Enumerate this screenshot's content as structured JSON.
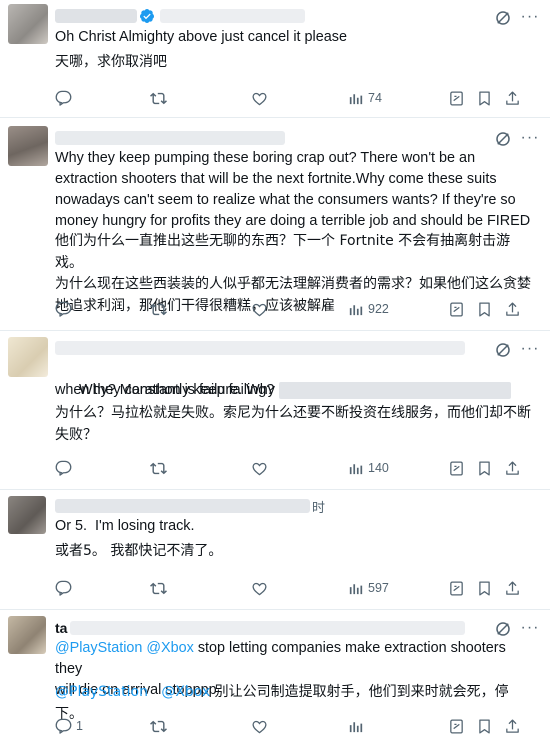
{
  "posts": [
    {
      "id": "post-1",
      "text_en": "Oh Christ Almighty above just cancel it please",
      "text_zh": "天哪，求你取消吧",
      "views": "74",
      "verified": true
    },
    {
      "id": "post-2",
      "text_en": "Why they keep pumping these boring crap out? There won't be an\nextraction shooters that will be the next fortnite.Why come these suits\nnowadays can't seem to realize what the consumers wants? If they're so\nmoney hungry for profits they are doing a terrible job and should be FIRED",
      "text_zh": "他们为什么一直推出这些无聊的东西？下一个 Fortnite 不会有抽离射击游戏。\n为什么现在这些西装装的人似乎都无法理解消费者的需求？如果他们这么贪婪\n地追求利润，那他们干得很糟糕，应该被解雇",
      "views": "922"
    },
    {
      "id": "post-3",
      "text_en_line1": "Why? Marathon is failure. Why",
      "text_en_line2": "when they constantly keep failing?",
      "text_zh": "为什么？马拉松就是失败。索尼为什么还要不断投资在线服务，而他们却不断\n失败？",
      "views": "140"
    },
    {
      "id": "post-4",
      "name_tail": "时",
      "text_en": "Or 5.  I'm losing track.",
      "text_zh": "或者5。 我都快记不清了。",
      "views": "597"
    },
    {
      "id": "post-5",
      "name_initial": "ta",
      "mention1": "@PlayStation",
      "mention2": "@Xbox",
      "text_en_rest": " stop letting companies make extraction shooters they\nwill die on arrival stopppp",
      "text_zh_rest": " 别让公司制造提取射手，他们到来时就会死，停下。",
      "replies": "1"
    }
  ],
  "colors": {
    "icon": "#536471",
    "accent": "#1d9bf0",
    "verified": "#1d9bf0"
  },
  "icons": [
    "reply-icon",
    "retweet-icon",
    "like-icon",
    "views-icon",
    "grok-icon",
    "bookmark-icon",
    "share-icon",
    "translate-icon",
    "more-icon",
    "verified-icon"
  ]
}
